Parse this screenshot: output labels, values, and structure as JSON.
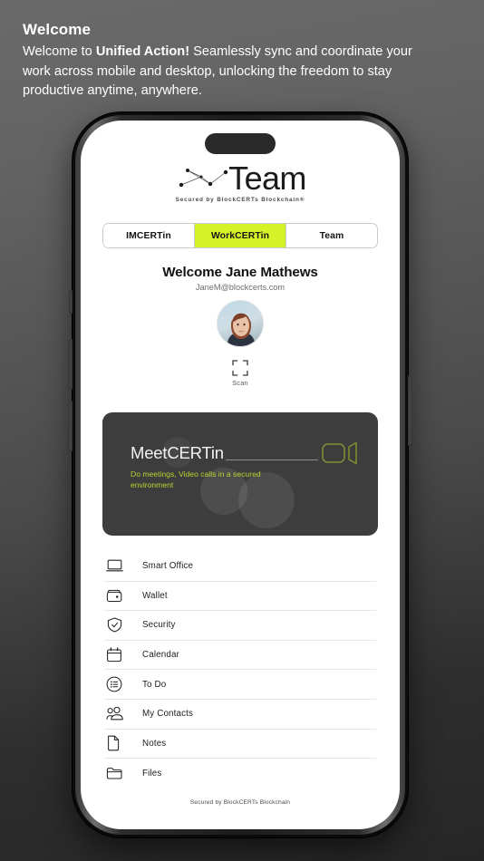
{
  "header": {
    "title": "Welcome",
    "body_prefix": "Welcome to ",
    "body_bold": "Unified Action!",
    "body_suffix": " Seamlessly sync and coordinate your work across mobile and desktop, unlocking the freedom to stay productive anytime, anywhere."
  },
  "brand": {
    "wordmark": "Team",
    "tagline": "Secured by BlockCERTs Blockchain®",
    "logo_icon": "constellation-network-icon"
  },
  "tabs": [
    {
      "label": "IMCERTin",
      "active": false
    },
    {
      "label": "WorkCERTin",
      "active": true
    },
    {
      "label": "Team",
      "active": false
    }
  ],
  "user": {
    "greeting": "Welcome Jane Mathews",
    "email": "JaneM@blockcerts.com",
    "avatar_icon": "user-avatar-photo"
  },
  "scan": {
    "label": "Scan",
    "icon": "scan-frame-icon"
  },
  "meet_card": {
    "title": "MeetCERTin",
    "subtitle": "Do meetings, Video calls in a secured environment",
    "icon": "video-camera-icon"
  },
  "menu": [
    {
      "label": "Smart Office",
      "icon": "laptop-icon"
    },
    {
      "label": "Wallet",
      "icon": "wallet-icon"
    },
    {
      "label": "Security",
      "icon": "shield-check-icon"
    },
    {
      "label": "Calendar",
      "icon": "calendar-icon"
    },
    {
      "label": "To Do",
      "icon": "checklist-circle-icon"
    },
    {
      "label": "My Contacts",
      "icon": "contacts-people-icon"
    },
    {
      "label": "Notes",
      "icon": "document-page-icon"
    },
    {
      "label": "Files",
      "icon": "folder-icon"
    }
  ],
  "footer": {
    "text": "Secured by BlockCERTs Blockchain"
  },
  "colors": {
    "accent_lime": "#d4f227",
    "card_bg": "#3d3d3d",
    "card_accent": "#b8d431",
    "page_bg_top": "#6a6a6a",
    "page_bg_bottom": "#262626"
  }
}
